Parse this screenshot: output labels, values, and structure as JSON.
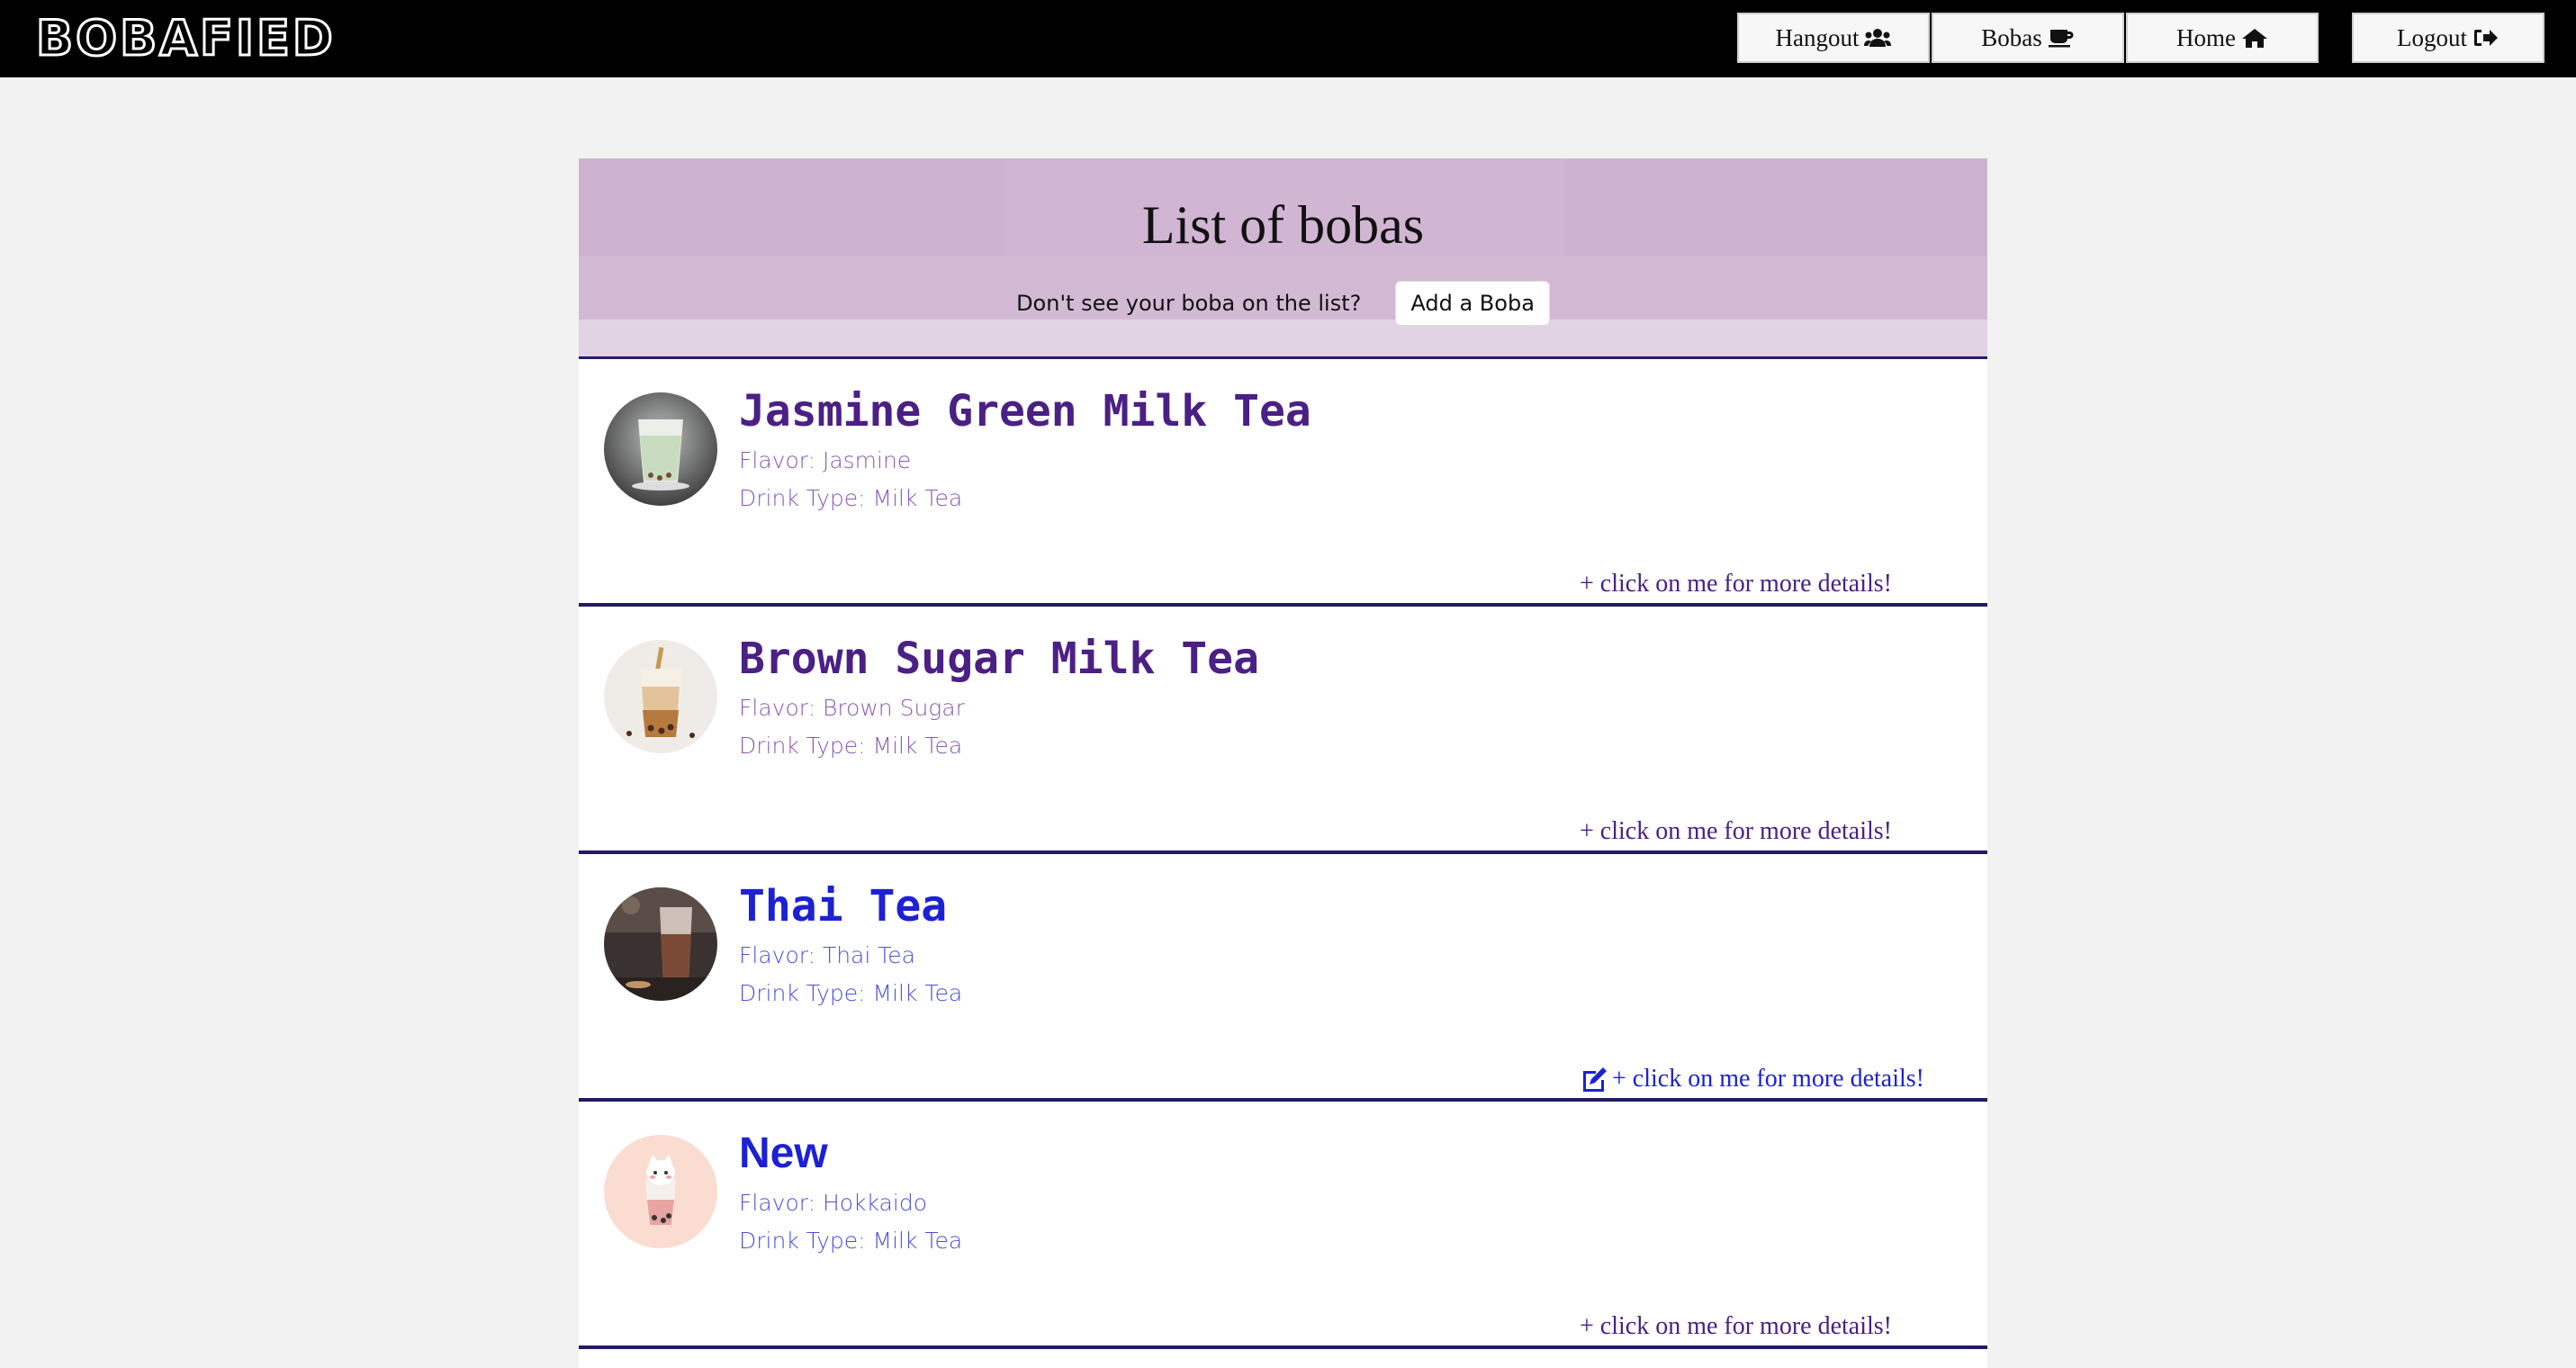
{
  "brand": "BOBAFIED",
  "nav": [
    {
      "label": "Hangout",
      "icon": "users-icon"
    },
    {
      "label": "Bobas",
      "icon": "coffee-cup-icon"
    },
    {
      "label": "Home",
      "icon": "home-icon"
    },
    {
      "label": "Logout",
      "icon": "sign-out-icon"
    }
  ],
  "page": {
    "title": "List of bobas",
    "prompt": "Don't see your boba on the list?",
    "add_button": "Add a Boba"
  },
  "bobas": [
    {
      "name": "Jasmine Green Milk Tea",
      "flavor": "Flavor: Jasmine",
      "type": "Drink Type: Milk Tea",
      "details": "+ click on me for more details!",
      "editable": false
    },
    {
      "name": "Brown Sugar Milk Tea",
      "flavor": "Flavor: Brown Sugar",
      "type": "Drink Type: Milk Tea",
      "details": "+ click on me for more details!",
      "editable": false
    },
    {
      "name": "Thai Tea",
      "flavor": "Flavor: Thai Tea",
      "type": "Drink Type: Milk Tea",
      "details": "+ click on me for more details!",
      "editable": true
    },
    {
      "name": "New",
      "flavor": "Flavor: Hokkaido",
      "type": "Drink Type: Milk Tea",
      "details": "+ click on me for more details!",
      "editable": false
    }
  ],
  "colors": {
    "header": "#ceb3d0",
    "purple_text": "#4b2084",
    "blue_text": "#1c22d2",
    "divider": "#231b63"
  }
}
